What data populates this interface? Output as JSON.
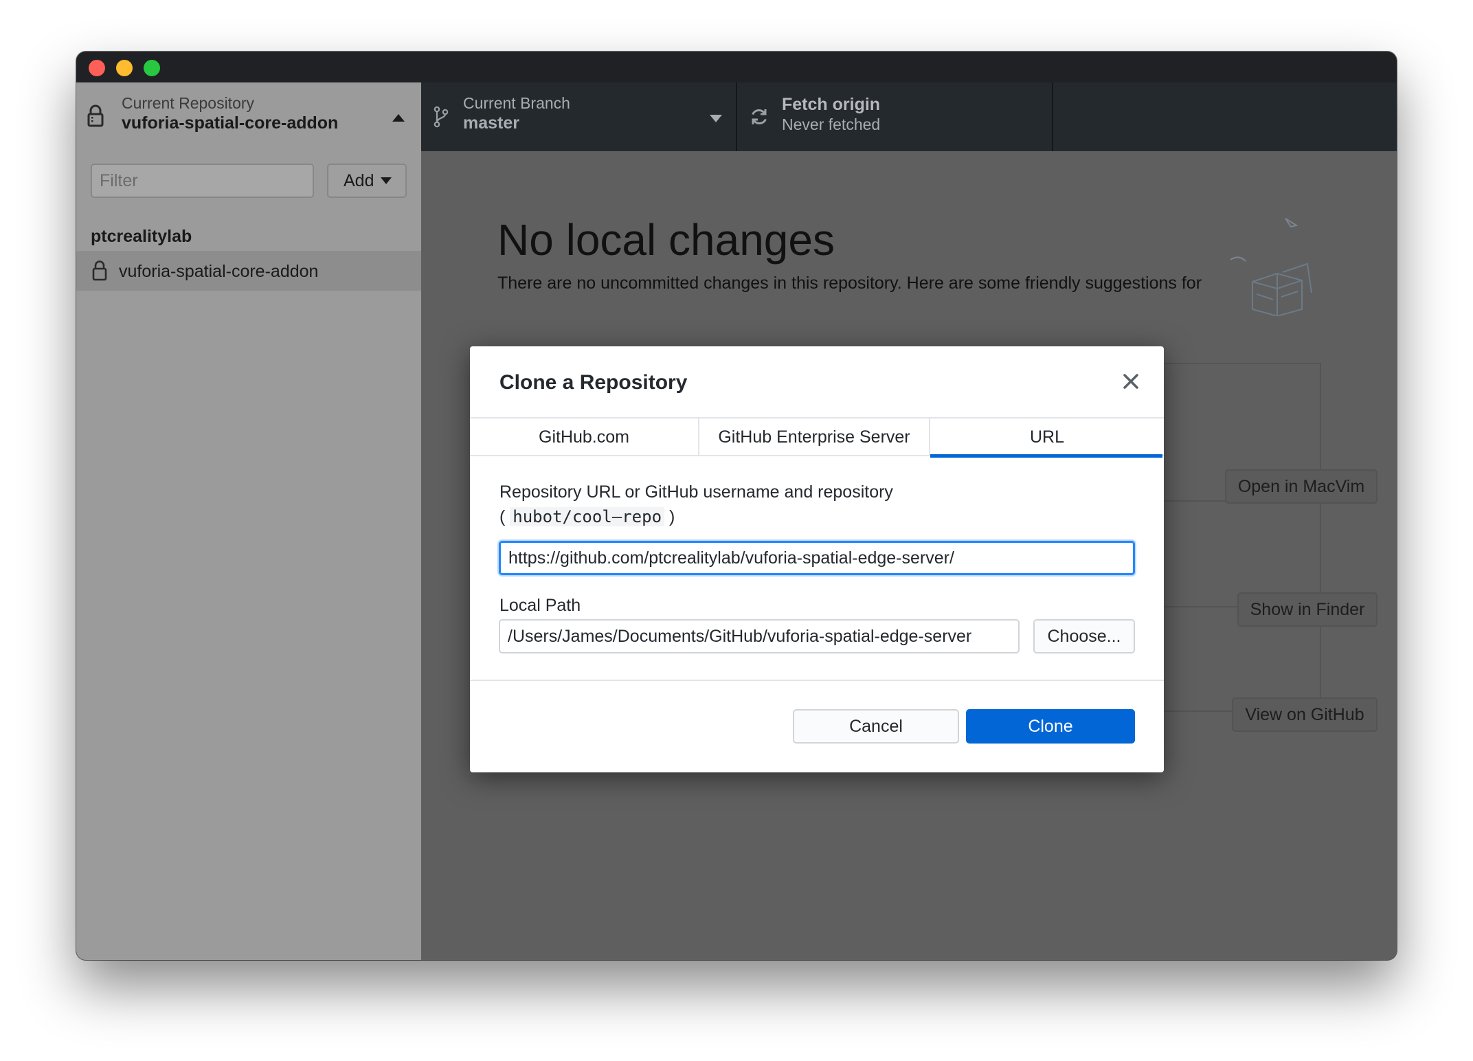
{
  "toolbar": {
    "repository": {
      "label": "Current Repository",
      "name": "vuforia-spatial-core-addon"
    },
    "branch": {
      "label": "Current Branch",
      "name": "master"
    },
    "fetch": {
      "title": "Fetch origin",
      "subtitle": "Never fetched"
    }
  },
  "sidebar": {
    "filter_placeholder": "Filter",
    "add_label": "Add",
    "group_name": "ptcrealitylab",
    "repos": [
      {
        "name": "vuforia-spatial-core-addon"
      }
    ]
  },
  "main": {
    "title": "No local changes",
    "description": "There are no uncommitted changes in this repository. Here are some friendly suggestions for",
    "actions": {
      "open_editor": "Open in MacVim",
      "show_finder": "Show in Finder",
      "view_github": "View on GitHub"
    }
  },
  "dialog": {
    "title": "Clone a Repository",
    "tabs": [
      {
        "label": "GitHub.com"
      },
      {
        "label": "GitHub Enterprise Server"
      },
      {
        "label": "URL"
      }
    ],
    "selected_tab": "URL",
    "url_label": "Repository URL or GitHub username and repository",
    "url_hint_open": "(",
    "url_hint_code": "hubot/cool–repo",
    "url_hint_close": ")",
    "url_value": "https://github.com/ptcrealitylab/vuforia-spatial-edge-server/",
    "path_label": "Local Path",
    "path_value": "/Users/James/Documents/GitHub/vuforia-spatial-edge-server",
    "choose_label": "Choose...",
    "cancel_label": "Cancel",
    "clone_label": "Clone"
  },
  "colors": {
    "accent": "#0366d6",
    "toolbar_bg": "#24292e",
    "overlay": "#5f5f5f"
  }
}
